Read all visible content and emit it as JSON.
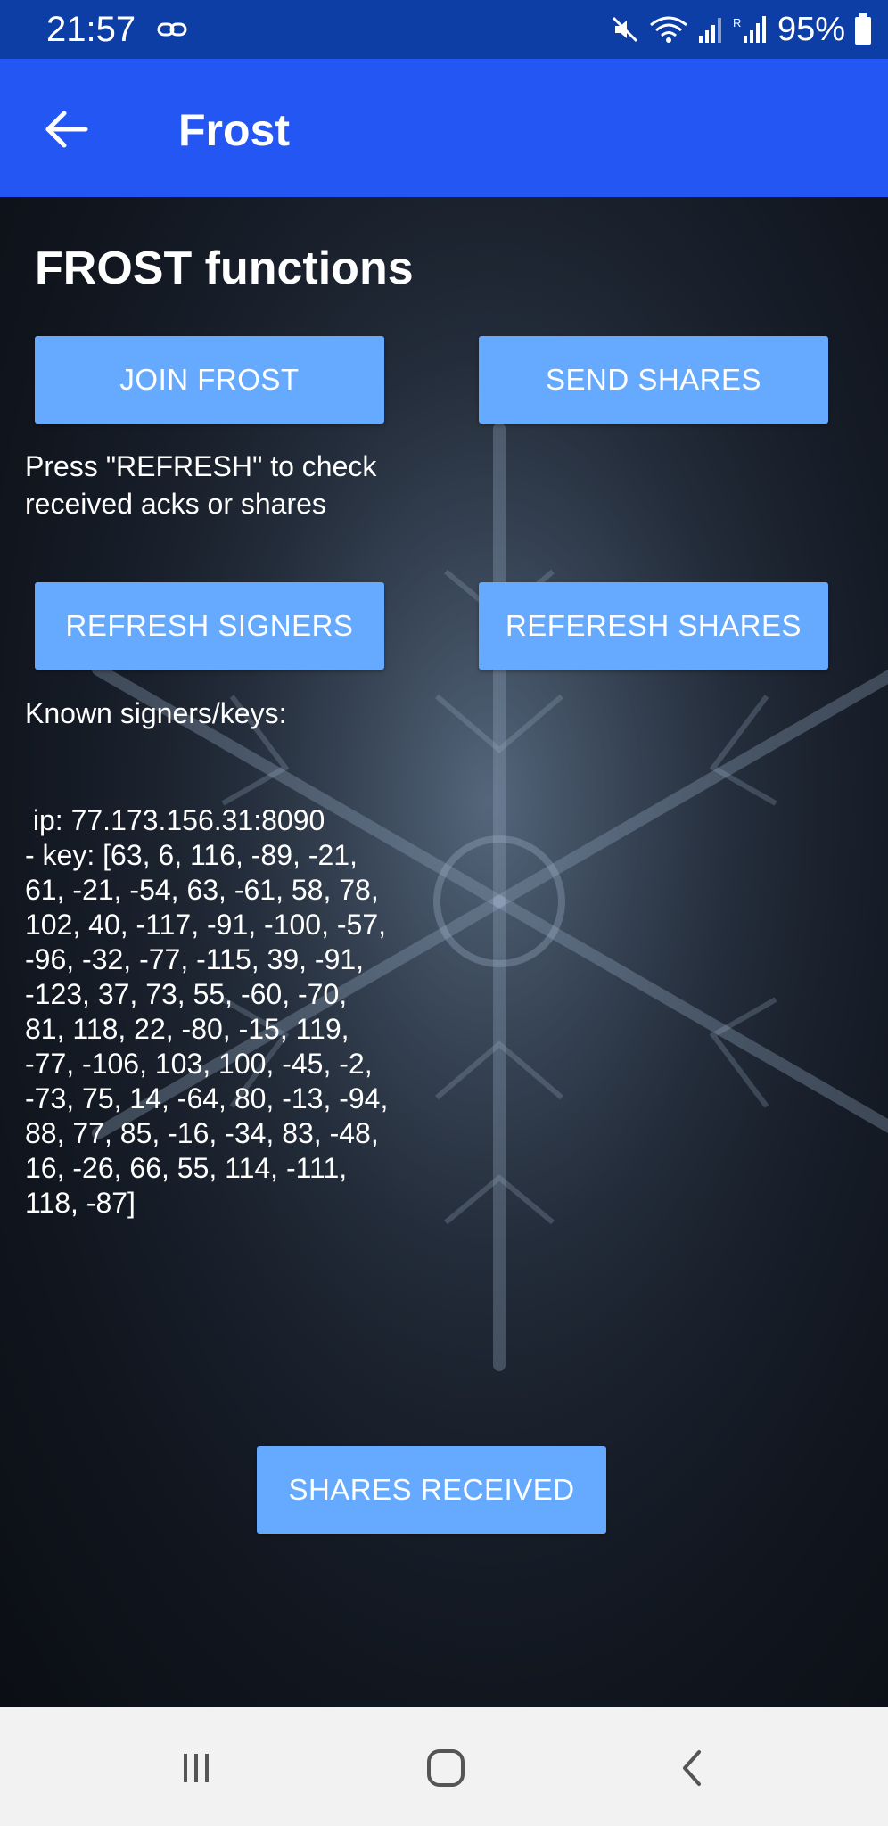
{
  "status_bar": {
    "time": "21:57",
    "battery_percent": "95%",
    "icons": [
      "link-icon",
      "mute-icon",
      "wifi-icon",
      "signal-icon",
      "roaming-signal-icon",
      "battery-icon"
    ]
  },
  "app_bar": {
    "title": "Frost",
    "back_icon": "arrow-left-icon"
  },
  "main": {
    "section_title": "FROST functions",
    "buttons": {
      "join": "JOIN FROST",
      "send_shares": "SEND SHARES",
      "refresh_signers": "REFRESH SIGNERS",
      "refresh_shares": "REFERESH SHARES",
      "shares_received": "SHARES RECEIVED"
    },
    "hint": "Press \"REFRESH\" to check received acks or shares",
    "known_signers_label": "Known signers/keys:",
    "signers_text": " ip: 77.173.156.31:8090\n- key: [63, 6, 116, -89, -21,\n61, -21, -54, 63, -61, 58, 78,\n102, 40, -117, -91, -100, -57,\n-96, -32, -77, -115, 39, -91,\n-123, 37, 73, 55, -60, -70,\n81, 118, 22, -80, -15, 119,\n-77, -106, 103, 100, -45, -2,\n-73, 75, 14, -64, 80, -13, -94,\n88, 77, 85, -16, -34, 83, -48,\n16, -26, 66, 55, 114, -111,\n118, -87]"
  },
  "nav_bar": {
    "icons": [
      "recents-icon",
      "home-icon",
      "back-icon"
    ]
  },
  "colors": {
    "status_bar": "#0d3ea6",
    "app_bar": "#2456f3",
    "button": "#66aaff",
    "nav_bar": "#f2f2f2"
  }
}
